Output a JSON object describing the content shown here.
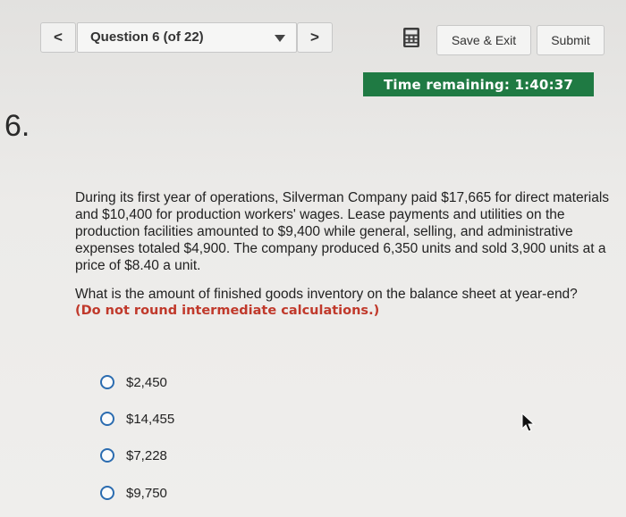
{
  "header": {
    "prev_label": "<",
    "next_label": ">",
    "question_selector": "Question 6 (of 22)",
    "save_label": "Save & Exit",
    "submit_label": "Submit",
    "timer_label": "Time remaining: 1:40:37"
  },
  "question": {
    "number": "6.",
    "text": "During its first year of operations, Silverman Company paid $17,665 for direct materials and $10,400 for production workers' wages. Lease payments and utilities on the production facilities amounted to $9,400 while general, selling, and administrative expenses totaled $4,900. The company produced 6,350 units and sold 3,900 units at a price of $8.40 a unit.",
    "prompt": "What is the amount of finished goods inventory on the balance sheet at year-end?",
    "note": "(Do not round intermediate calculations.)"
  },
  "choices": [
    {
      "label": "$2,450"
    },
    {
      "label": "$14,455"
    },
    {
      "label": "$7,228"
    },
    {
      "label": "$9,750"
    }
  ],
  "colors": {
    "timer_bg": "#1f7a43",
    "note": "#c0392b",
    "radio_border": "#2b6cb0"
  },
  "icons": {
    "calculator": "calculator-icon",
    "dropdown": "chevron-down-icon",
    "cursor": "mouse-pointer-icon"
  }
}
